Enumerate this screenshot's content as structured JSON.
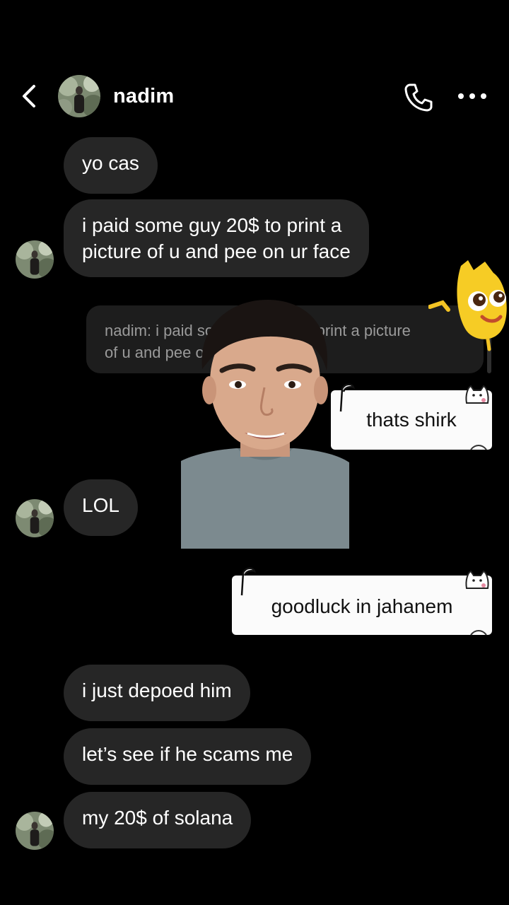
{
  "header": {
    "contact_name": "nadim",
    "back_icon": "chevron-left-icon",
    "call_icon": "phone-icon",
    "more_icon": "more-horizontal-icon"
  },
  "messages": [
    {
      "text": "yo cas"
    },
    {
      "text": "i paid some guy 20$ to print a picture of u and pee on ur face",
      "lines": [
        "i paid some guy 20$ to print a",
        "picture of u and pee on ur face"
      ]
    },
    {
      "text": "LOL"
    },
    {
      "text": "i just depoed him"
    },
    {
      "text": "let’s see if he scams me"
    },
    {
      "text": "my 20$ of solana"
    }
  ],
  "reply_quote": {
    "line1": "nadim: i paid some guy 20$ to print a picture",
    "line2": "of u and pee on ur face"
  },
  "sent_notes": [
    {
      "text": "thats shirk"
    },
    {
      "text": "goodluck in jahanem"
    }
  ],
  "colors": {
    "background": "#000000",
    "received_bubble": "#262626",
    "reply_quote_bg": "#1d1d1d",
    "note_bg": "#fbfbfb"
  }
}
